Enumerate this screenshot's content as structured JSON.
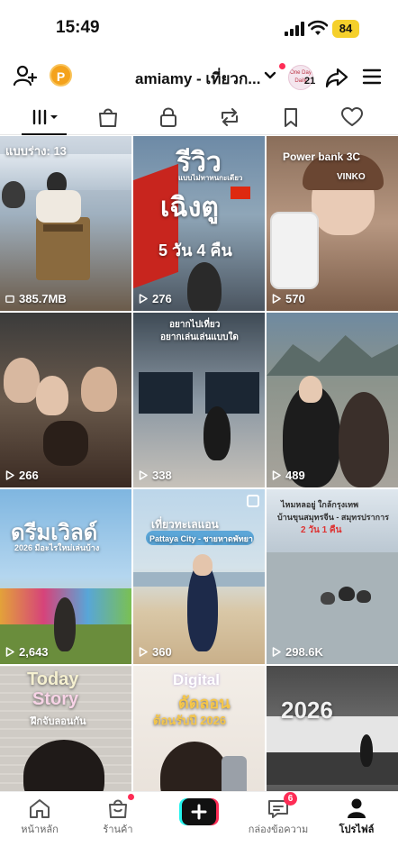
{
  "status_bar": {
    "time": "15:49",
    "battery": "84"
  },
  "header": {
    "username": "amiamy - เที่ยวก...",
    "coin_label": "P",
    "avatar_text": "One Day Daily",
    "avatar_badge": "21",
    "icons": [
      "add-user-icon",
      "coin-icon",
      "chevron-down-icon",
      "share-icon",
      "menu-icon"
    ]
  },
  "tabs": [
    "videos-tab",
    "shop-tab",
    "private-tab",
    "repost-tab",
    "favorites-tab",
    "liked-tab"
  ],
  "grid": [
    {
      "top_label": "แบบร่าง: 13",
      "views": "385.7MB",
      "kind": "drafts"
    },
    {
      "title": "รีวิว",
      "subtitle": "แบบไม่ทาทนกะเดียว",
      "title2": "เฉิงตู",
      "caption": "5 วัน 4 คืน",
      "views": "276"
    },
    {
      "title": "Power bank 3C",
      "subtitle": "VINKO",
      "views": "570"
    },
    {
      "views": "266"
    },
    {
      "title": "อยากไปเที่ยว",
      "subtitle": "อยากเล่นเล่นแบบใด",
      "views": "338"
    },
    {
      "views": "489"
    },
    {
      "title": "ดรีมเวิลด์",
      "subtitle": "2026 มีอะไรใหม่เล่นบ้าง",
      "views": "2,643"
    },
    {
      "title": "เที่ยวทะเลแอน",
      "subtitle": "Pattaya City - ชายหาดพัทยา",
      "views": "360"
    },
    {
      "title": "ไหมหลอยู่ ใกล้กรุงเทพ",
      "subtitle": "บ้านขุนสมุทรจีน - สมุทรปราการ",
      "caption": "2 วัน 1 คืน",
      "views": "298.6K"
    },
    {
      "title": "Today",
      "title2": "Story",
      "subtitle": "ฝึกจับลอนกัน"
    },
    {
      "title": "Digital",
      "title2": "ดัดลอน",
      "subtitle": "ต้อนรับปี 2026"
    },
    {
      "title": "2026"
    }
  ],
  "nav": {
    "home": "หน้าหลัก",
    "shop": "ร้านค้า",
    "inbox": "กล่องข้อความ",
    "inbox_count": "6",
    "profile": "โปรไฟล์"
  },
  "colors": {
    "accent": "#fe2c55",
    "battery": "#f5d02b",
    "coin": "#f4a21c"
  }
}
